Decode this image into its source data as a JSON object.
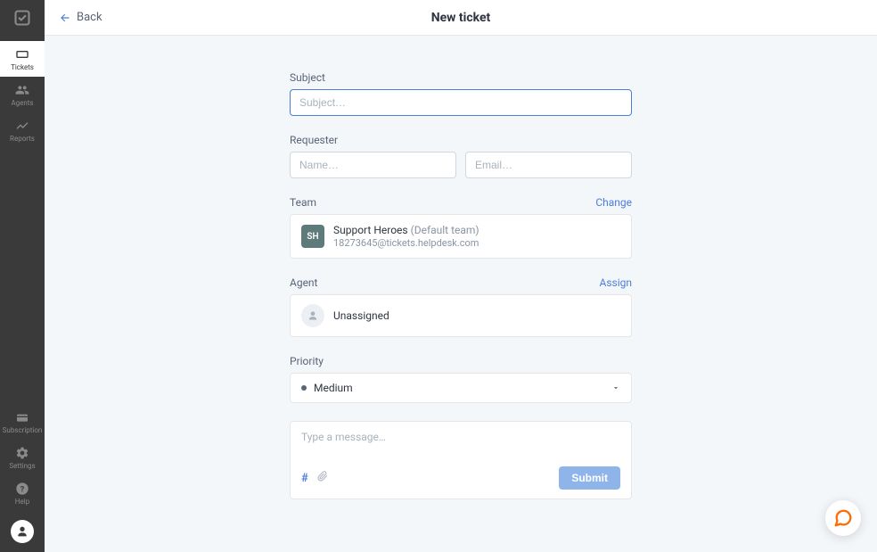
{
  "sidebar": {
    "items": [
      {
        "label": "Tickets"
      },
      {
        "label": "Agents"
      },
      {
        "label": "Reports"
      }
    ],
    "bottom": [
      {
        "label": "Subscription"
      },
      {
        "label": "Settings"
      },
      {
        "label": "Help"
      }
    ]
  },
  "header": {
    "back_label": "Back",
    "title": "New ticket"
  },
  "form": {
    "subject": {
      "label": "Subject",
      "placeholder": "Subject…",
      "value": ""
    },
    "requester": {
      "label": "Requester",
      "name_placeholder": "Name…",
      "email_placeholder": "Email…"
    },
    "team": {
      "label": "Team",
      "action": "Change",
      "avatar_initials": "SH",
      "name": "Support Heroes",
      "default_suffix": "(Default team)",
      "email": "18273645@tickets.helpdesk.com"
    },
    "agent": {
      "label": "Agent",
      "action": "Assign",
      "value": "Unassigned"
    },
    "priority": {
      "label": "Priority",
      "value": "Medium"
    },
    "message": {
      "placeholder": "Type a message…",
      "submit_label": "Submit"
    }
  }
}
